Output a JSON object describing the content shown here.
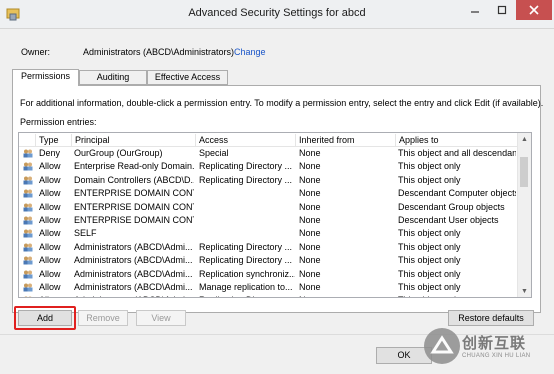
{
  "window": {
    "title": "Advanced Security Settings for abcd"
  },
  "owner": {
    "label": "Owner:",
    "value": "Administrators (ABCD\\Administrators)",
    "change_link": "Change"
  },
  "tabs": [
    {
      "label": "Permissions",
      "active": true
    },
    {
      "label": "Auditing",
      "active": false
    },
    {
      "label": "Effective Access",
      "active": false
    }
  ],
  "info_text": "For additional information, double-click a permission entry. To modify a permission entry, select the entry and click Edit (if available).",
  "entries_label": "Permission entries:",
  "columns": [
    "Type",
    "Principal",
    "Access",
    "Inherited from",
    "Applies to"
  ],
  "rows": [
    {
      "type": "Deny",
      "principal": "OurGroup          (OurGroup)",
      "access": "Special",
      "inherited": "None",
      "applies": "This object and all descendan..."
    },
    {
      "type": "Allow",
      "principal": "Enterprise Read-only Domain...",
      "access": "Replicating Directory ...",
      "inherited": "None",
      "applies": "This object only"
    },
    {
      "type": "Allow",
      "principal": "Domain Controllers (ABCD\\D...",
      "access": "Replicating Directory ...",
      "inherited": "None",
      "applies": "This object only"
    },
    {
      "type": "Allow",
      "principal": "ENTERPRISE DOMAIN CONT...",
      "access": "",
      "inherited": "None",
      "applies": "Descendant Computer objects"
    },
    {
      "type": "Allow",
      "principal": "ENTERPRISE DOMAIN CONT...",
      "access": "",
      "inherited": "None",
      "applies": "Descendant Group objects"
    },
    {
      "type": "Allow",
      "principal": "ENTERPRISE DOMAIN CONT...",
      "access": "",
      "inherited": "None",
      "applies": "Descendant User objects"
    },
    {
      "type": "Allow",
      "principal": "SELF",
      "access": "",
      "inherited": "None",
      "applies": "This object only"
    },
    {
      "type": "Allow",
      "principal": "Administrators (ABCD\\Admi...",
      "access": "Replicating Directory ...",
      "inherited": "None",
      "applies": "This object only"
    },
    {
      "type": "Allow",
      "principal": "Administrators (ABCD\\Admi...",
      "access": "Replicating Directory ...",
      "inherited": "None",
      "applies": "This object only"
    },
    {
      "type": "Allow",
      "principal": "Administrators (ABCD\\Admi...",
      "access": "Replication synchroniz...",
      "inherited": "None",
      "applies": "This object only"
    },
    {
      "type": "Allow",
      "principal": "Administrators (ABCD\\Admi...",
      "access": "Manage replication to...",
      "inherited": "None",
      "applies": "This object only"
    },
    {
      "type": "Allow",
      "principal": "Administrators (ABCD\\Admi...",
      "access": "Replicating Director...",
      "inherited": "None",
      "applies": "This object only"
    }
  ],
  "buttons": {
    "add": "Add",
    "remove": "Remove",
    "view": "View",
    "restore": "Restore defaults",
    "ok": "OK"
  },
  "watermark": {
    "cn": "创新互联",
    "en": "CHUANG XIN HU LIAN"
  },
  "colors": {
    "accent_link": "#1a55c8",
    "highlight": "#e0201f",
    "close_button": "#c75050"
  }
}
